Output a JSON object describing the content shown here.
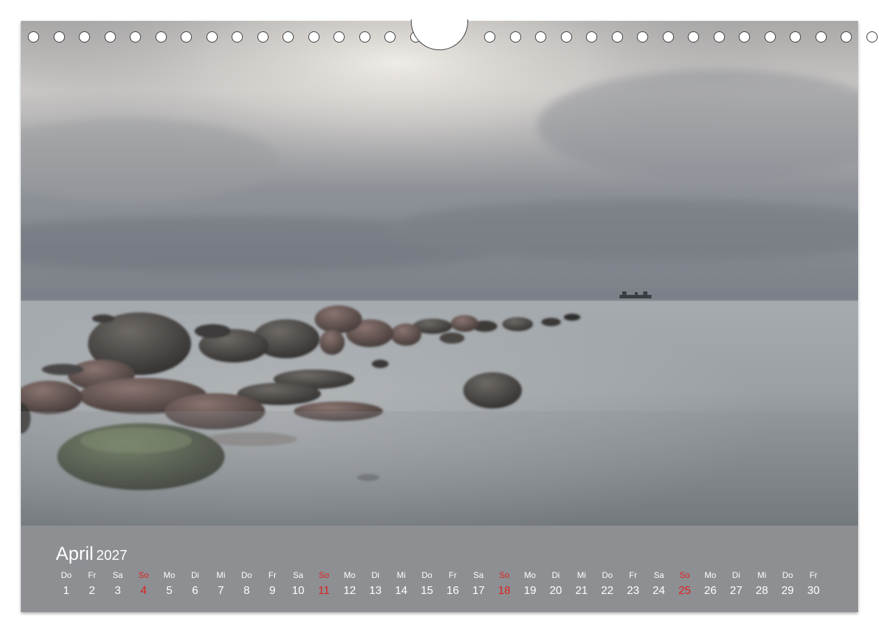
{
  "calendar": {
    "month": "April",
    "year": "2027",
    "weekend_color": "#e0201c",
    "days": [
      {
        "wd": "Do",
        "d": "1"
      },
      {
        "wd": "Fr",
        "d": "2"
      },
      {
        "wd": "Sa",
        "d": "3"
      },
      {
        "wd": "So",
        "d": "4",
        "sunday": true
      },
      {
        "wd": "Mo",
        "d": "5"
      },
      {
        "wd": "Di",
        "d": "6"
      },
      {
        "wd": "Mi",
        "d": "7"
      },
      {
        "wd": "Do",
        "d": "8"
      },
      {
        "wd": "Fr",
        "d": "9"
      },
      {
        "wd": "Sa",
        "d": "10"
      },
      {
        "wd": "So",
        "d": "11",
        "sunday": true
      },
      {
        "wd": "Mo",
        "d": "12"
      },
      {
        "wd": "Di",
        "d": "13"
      },
      {
        "wd": "Mi",
        "d": "14"
      },
      {
        "wd": "Do",
        "d": "15"
      },
      {
        "wd": "Fr",
        "d": "16"
      },
      {
        "wd": "Sa",
        "d": "17"
      },
      {
        "wd": "So",
        "d": "18",
        "sunday": true
      },
      {
        "wd": "Mo",
        "d": "19"
      },
      {
        "wd": "Di",
        "d": "20"
      },
      {
        "wd": "Mi",
        "d": "21"
      },
      {
        "wd": "Do",
        "d": "22"
      },
      {
        "wd": "Fr",
        "d": "23"
      },
      {
        "wd": "Sa",
        "d": "24"
      },
      {
        "wd": "So",
        "d": "25",
        "sunday": true
      },
      {
        "wd": "Mo",
        "d": "26"
      },
      {
        "wd": "Di",
        "d": "27"
      },
      {
        "wd": "Mi",
        "d": "28"
      },
      {
        "wd": "Do",
        "d": "29"
      },
      {
        "wd": "Fr",
        "d": "30"
      }
    ]
  },
  "binding": {
    "hole_count": 32
  }
}
